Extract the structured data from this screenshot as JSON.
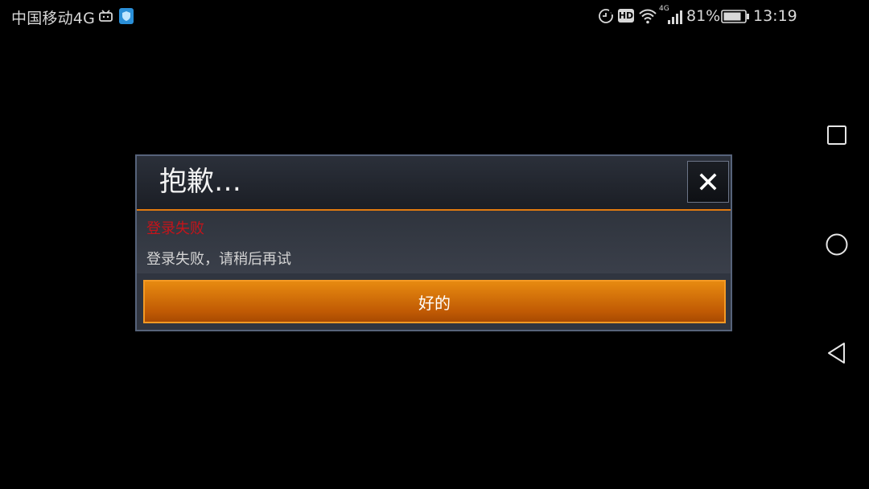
{
  "status_bar": {
    "carrier": "中国移动4G",
    "battery_percent": "81%",
    "time": "13:19",
    "hd_label": "HD",
    "network_label": "4G",
    "icons": [
      "tv-icon",
      "shield-icon",
      "sync-icon",
      "hd-icon",
      "wifi-icon",
      "signal-icon",
      "battery-icon"
    ]
  },
  "dialog": {
    "title": "抱歉…",
    "error_title": "登录失败",
    "error_message": "登录失败，请稍后再试",
    "ok_label": "好的",
    "close_icon": "close-icon"
  },
  "nav_bar": {
    "icons": [
      "recent-apps-icon",
      "home-icon",
      "back-icon"
    ]
  },
  "colors": {
    "background": "#000000",
    "accent": "#e07a10",
    "error": "#c5141a",
    "button": "#d06a08"
  }
}
